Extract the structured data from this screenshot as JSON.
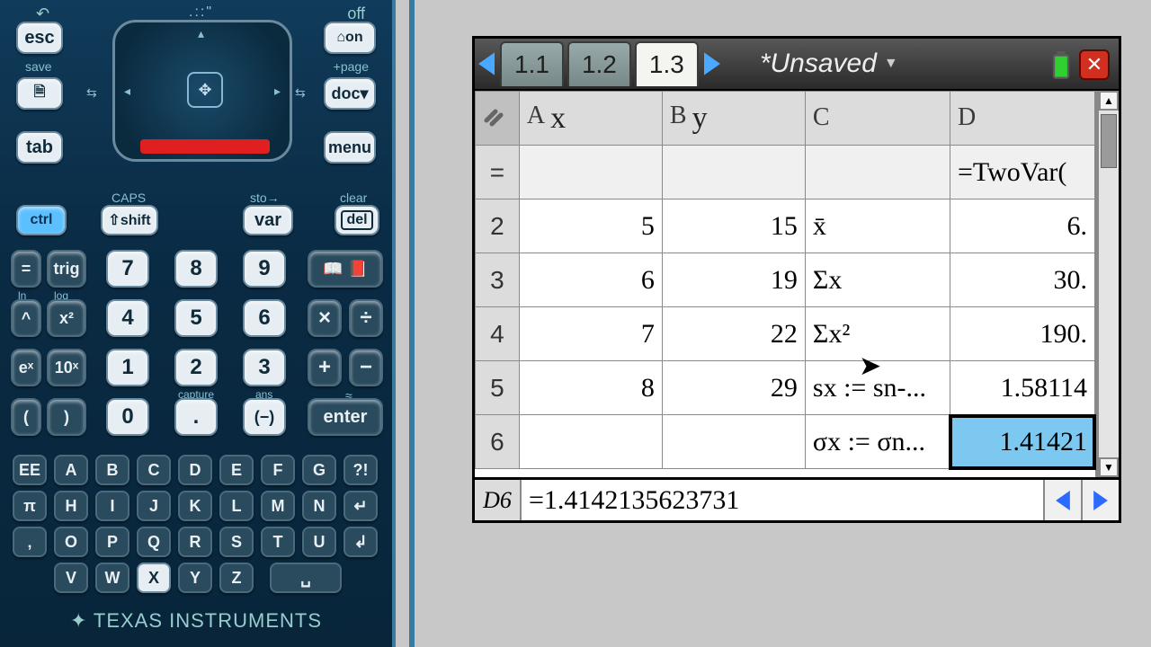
{
  "calc": {
    "brand": "TEXAS INSTRUMENTS",
    "topLabels": {
      "undo": "↶",
      "squig": ".::\"",
      "off": "off",
      "save": "save",
      "page": "+page",
      "caps": "CAPS",
      "sto": "sto→",
      "clear": "clear",
      "capture": "capture",
      "ans": "ans",
      "approx": "≈",
      "ln": "ln",
      "log": "log",
      "ee_small": "[ ]",
      "paren_small": "{ }"
    },
    "keys": {
      "esc": "esc",
      "tab": "tab",
      "on": "⌂on",
      "doc": "doc▾",
      "menu": "menu",
      "ctrl": "ctrl",
      "shift": "⇧shift",
      "var": "var",
      "del": "del",
      "eq": "=",
      "trig": "trig",
      "n7": "7",
      "n8": "8",
      "n9": "9",
      "book": "📖",
      "caret": "^",
      "xsq": "x²",
      "n4": "4",
      "n5": "5",
      "n6": "6",
      "mul": "×",
      "div": "÷",
      "ex": "eˣ",
      "tenx": "10ˣ",
      "n1": "1",
      "n2": "2",
      "n3": "3",
      "plus": "+",
      "minus": "−",
      "lpar": "(",
      "rpar": ")",
      "n0": "0",
      "dot": ".",
      "neg": "(−)",
      "enter": "enter",
      "saveicon": "🗎"
    },
    "alpha": {
      "r1": [
        "EE",
        "A",
        "B",
        "C",
        "D",
        "E",
        "F",
        "G",
        "?!"
      ],
      "r2": [
        "π",
        "H",
        "I",
        "J",
        "K",
        "L",
        "M",
        "N",
        "↵"
      ],
      "r3": [
        "‚",
        "O",
        "P",
        "Q",
        "R",
        "S",
        "T",
        "U",
        "↲"
      ],
      "r4": [
        "V",
        "W",
        "X",
        "Y",
        "Z"
      ],
      "space": "␣"
    }
  },
  "screen": {
    "tabs": [
      "1.1",
      "1.2",
      "1.3"
    ],
    "activeTab": 2,
    "title": "*Unsaved",
    "columns": [
      {
        "letter": "A",
        "var": "x"
      },
      {
        "letter": "B",
        "var": "y"
      },
      {
        "letter": "C",
        "var": ""
      },
      {
        "letter": "D",
        "var": ""
      }
    ],
    "formulaRow": [
      "",
      "",
      "",
      "=TwoVar("
    ],
    "rows": [
      {
        "n": "2",
        "a": "5",
        "b": "15",
        "c": "x̄",
        "d": "6."
      },
      {
        "n": "3",
        "a": "6",
        "b": "19",
        "c": "Σx",
        "d": "30."
      },
      {
        "n": "4",
        "a": "7",
        "b": "22",
        "c": "Σx²",
        "d": "190."
      },
      {
        "n": "5",
        "a": "8",
        "b": "29",
        "c": "sx := sn-...",
        "d": "1.58114"
      },
      {
        "n": "6",
        "a": "",
        "b": "",
        "c": "σx := σn...",
        "d": "1.41421"
      }
    ],
    "selectedCellRef": "D6",
    "selectedCellValue": "=1.4142135623731"
  }
}
